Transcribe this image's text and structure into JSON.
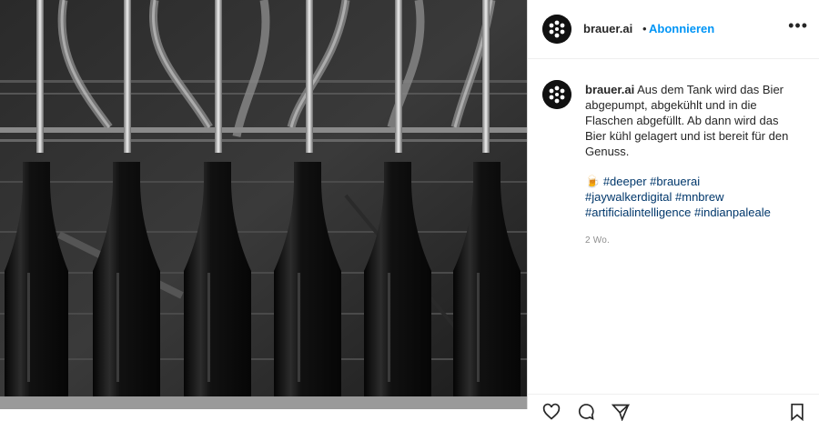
{
  "header": {
    "username": "brauer.ai",
    "separator": "•",
    "follow_label": "Abonnieren",
    "more_icon": "more-icon"
  },
  "caption": {
    "username": "brauer.ai",
    "text": "Aus dem Tank wird das Bier abgepumpt, abgekühlt und in die Flaschen abgefüllt. Ab dann wird das Bier kühl gelagert und ist bereit für den Genuss.",
    "emoji": "🍺",
    "hashtags": [
      "#deeper",
      "#brauerai",
      "#jaywalkerdigital",
      "#mnbrew",
      "#artificialintelligence",
      "#indianpaleale"
    ]
  },
  "timestamp": "2 Wo.",
  "actions": [
    "heart-icon",
    "comment-icon",
    "share-icon",
    "bookmark-icon"
  ],
  "colors": {
    "accent": "#0095f6",
    "hashtag": "#00376b",
    "muted": "#8e8e8e"
  }
}
